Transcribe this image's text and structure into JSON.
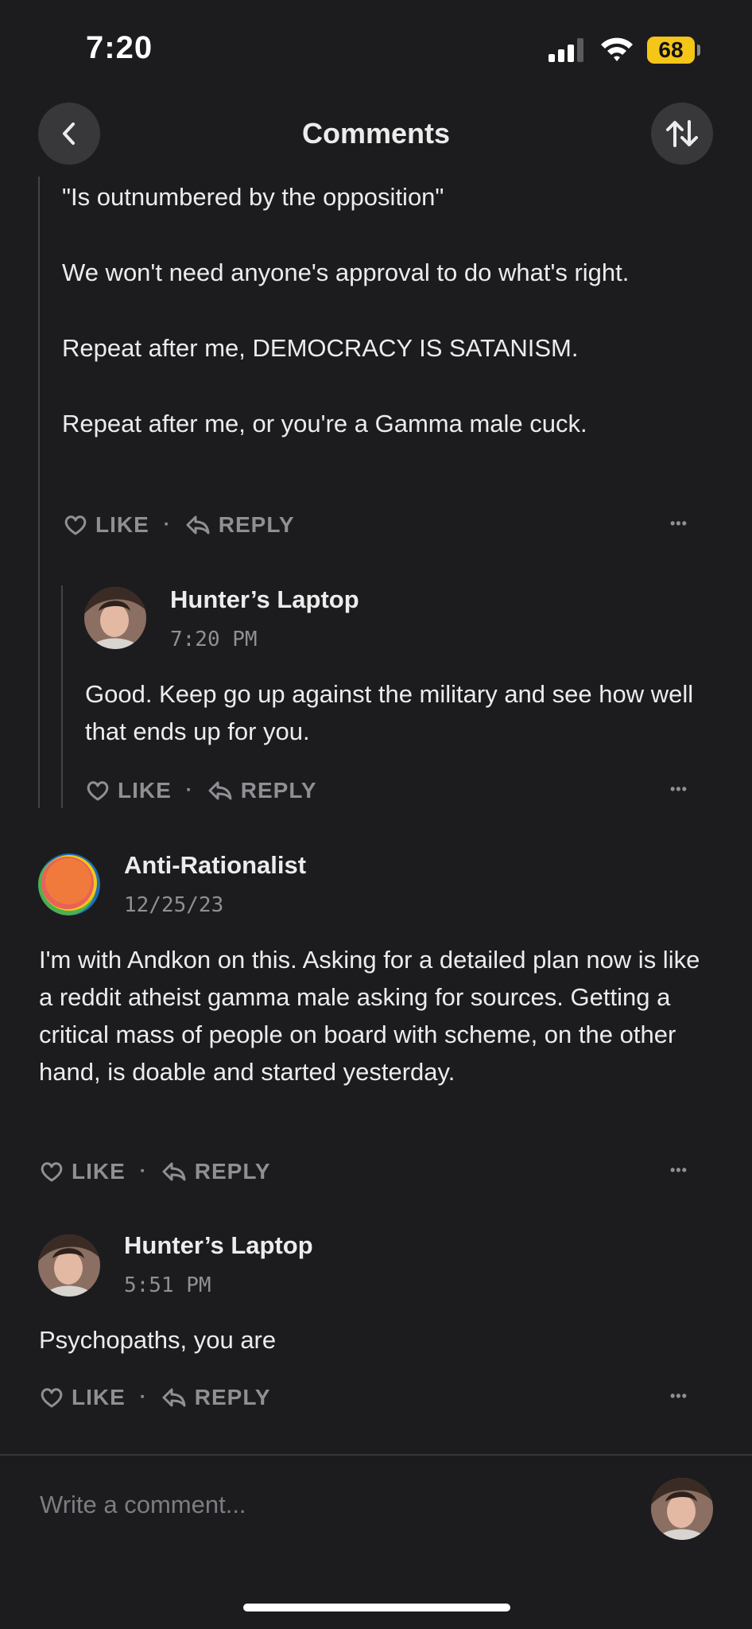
{
  "status_bar": {
    "time": "7:20",
    "battery": "68"
  },
  "header": {
    "title": "Comments"
  },
  "comments": [
    {
      "body": [
        "\"Is outnumbered by the opposition\"",
        "We won't need anyone's approval to do what's right.",
        "Repeat after me, DEMOCRACY IS SATANISM.",
        "Repeat after me, or you're a Gamma male cuck."
      ],
      "like_label": "LIKE",
      "reply_label": "REPLY",
      "more_label": "•••"
    },
    {
      "author": "Hunter’s Laptop",
      "timestamp": "7:20 PM",
      "body": "Good. Keep go up against the military and see how well that ends up for you.",
      "like_label": "LIKE",
      "reply_label": "REPLY",
      "more_label": "•••"
    },
    {
      "author": "Anti-Rationalist",
      "timestamp": "12/25/23",
      "body": "I'm with Andkon on this. Asking for a detailed plan now is like a reddit atheist gamma male asking for sources. Getting a critical mass of people on board with scheme, on the other hand, is doable and started yesterday.",
      "like_label": "LIKE",
      "reply_label": "REPLY",
      "more_label": "•••"
    },
    {
      "author": "Hunter’s Laptop",
      "timestamp": "5:51 PM",
      "body": "Psychopaths, you are",
      "like_label": "LIKE",
      "reply_label": "REPLY",
      "more_label": "•••"
    }
  ],
  "composer": {
    "placeholder": "Write a comment..."
  },
  "colors": {
    "background": "#1c1c1f",
    "text": "#ececec",
    "muted": "#8f8f94",
    "battery": "#f5c518"
  }
}
